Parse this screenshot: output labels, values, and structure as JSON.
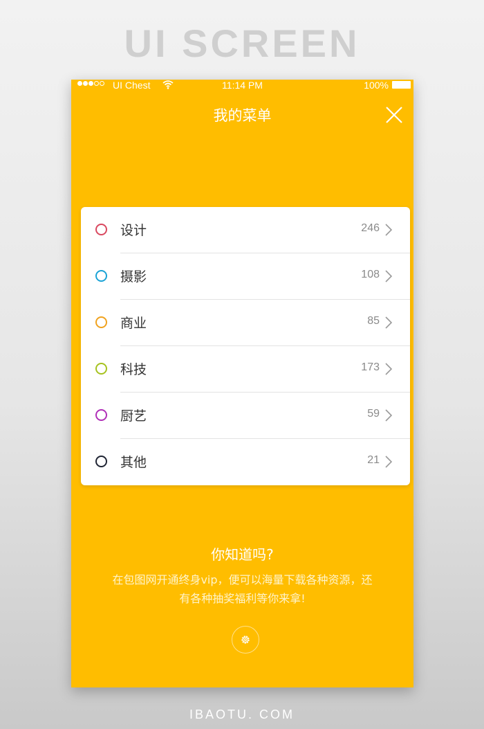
{
  "banner": {
    "title": "UI SCREEN",
    "footer": "IBAOTU. COM"
  },
  "status_bar": {
    "signal_dots_filled": 3,
    "signal_dots_total": 5,
    "carrier": "UI Chest",
    "wifi_icon": "wifi-icon",
    "time": "11:14 PM",
    "battery_percent": "100%",
    "battery_level": 1.0
  },
  "nav": {
    "title": "我的菜单",
    "close_icon": "close-icon"
  },
  "menu": {
    "items": [
      {
        "label": "设计",
        "count": "246",
        "color": "#d9485f"
      },
      {
        "label": "摄影",
        "count": "108",
        "color": "#1aa3d6"
      },
      {
        "label": "商业",
        "count": "85",
        "color": "#f0a21e"
      },
      {
        "label": "科技",
        "count": "173",
        "color": "#a6c21f"
      },
      {
        "label": "厨艺",
        "count": "59",
        "color": "#b02fb8"
      },
      {
        "label": "其他",
        "count": "21",
        "color": "#1f2433"
      }
    ]
  },
  "tip": {
    "title": "你知道吗?",
    "line1": "在包图网开通终身vip，便可以海量下载各种资源，还",
    "line2": "有各种抽奖福利等你来拿!"
  },
  "colors": {
    "accent": "#ffbd00",
    "card": "#ffffff",
    "text": "#333333",
    "muted": "#8a8a8a"
  },
  "icons": {
    "settings": "gear-icon",
    "chevron": "chevron-right-icon"
  }
}
